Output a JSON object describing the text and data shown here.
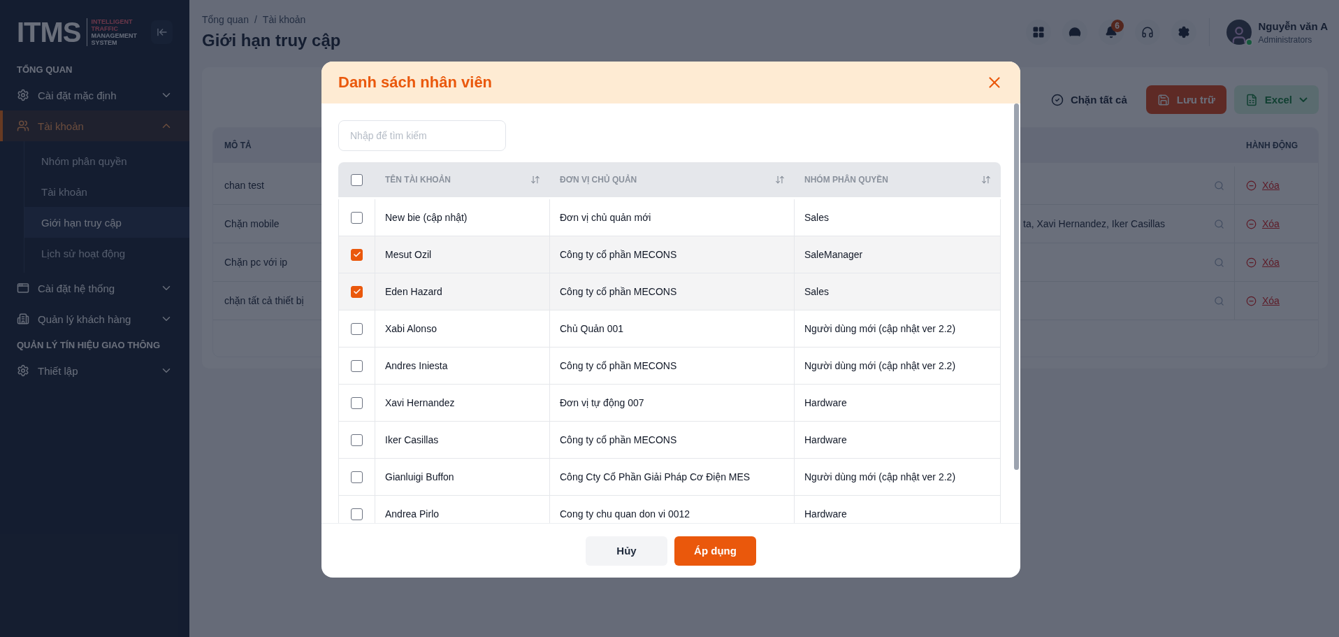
{
  "sidebar": {
    "logo": {
      "mark": "ITMS",
      "tagline": [
        "INTELLIGENT",
        "TRAFFIC",
        "MANAGEMENT",
        "SYSTEM"
      ]
    },
    "sections": [
      {
        "heading": "TỔNG QUAN",
        "items": [
          {
            "label": "Cài đặt mặc định",
            "selected": false,
            "expanded": false
          },
          {
            "label": "Tài khoản",
            "selected": true,
            "expanded": true,
            "children": [
              {
                "label": "Nhóm phân quyền",
                "selected": false
              },
              {
                "label": "Tài khoản",
                "selected": false
              },
              {
                "label": "Giới hạn truy cập",
                "selected": true
              },
              {
                "label": "Lịch sử hoạt động",
                "selected": false
              }
            ]
          },
          {
            "label": "Cài đặt hệ thống",
            "selected": false,
            "expanded": false
          },
          {
            "label": "Quản lý khách hàng",
            "selected": false,
            "expanded": false
          }
        ]
      },
      {
        "heading": "QUẢN LÝ TÍN HIỆU GIAO THÔNG",
        "items": [
          {
            "label": "Thiết lập",
            "selected": false,
            "expanded": false
          }
        ]
      }
    ]
  },
  "header": {
    "breadcrumb": [
      "Tổng quan",
      "Tài khoản"
    ],
    "separator": "/",
    "title": "Giới hạn truy cập",
    "notification_count": "6",
    "user": {
      "name": "Nguyễn văn A",
      "role": "Administrators"
    }
  },
  "toolbar": {
    "buttons": [
      {
        "label": "Chặn tất cả",
        "kind": "outline"
      },
      {
        "label": "Lưu trữ",
        "kind": "primary"
      },
      {
        "label": "Excel",
        "kind": "excel"
      }
    ]
  },
  "table": {
    "columns": [
      "MÔ TẢ",
      "HÀNH ĐỘNG"
    ],
    "rows": [
      {
        "description": "chan test",
        "action": "Xóa"
      },
      {
        "description": "Chặn mobile",
        "column_3": "ta, Xavi Hernandez, Iker Casillas",
        "action": "Xóa"
      },
      {
        "description": "Chặn pc với ip",
        "action": "Xóa"
      },
      {
        "description": "chặn tất cả thiết bị",
        "action": "Xóa"
      }
    ]
  },
  "modal": {
    "title": "Danh sách nhân viên",
    "search": {
      "placeholder": "Nhập để tìm kiếm"
    },
    "select_all": {
      "checked": false
    },
    "columns": [
      {
        "label": "TÊN TÀI KHOẢN",
        "sortable": true
      },
      {
        "label": "ĐƠN VỊ CHỦ QUẢN",
        "sortable": true
      },
      {
        "label": "NHÓM PHÂN QUYỀN",
        "sortable": true
      }
    ],
    "rows": [
      {
        "name": "New bie (cập nhật)",
        "unit": "Đơn vị chủ quản mới",
        "group": "Sales",
        "checked": false
      },
      {
        "name": "Mesut Ozil",
        "unit": "Công ty cổ phần MECONS",
        "group": "SaleManager",
        "checked": true
      },
      {
        "name": "Eden Hazard",
        "unit": "Công ty cổ phần MECONS",
        "group": "Sales",
        "checked": true
      },
      {
        "name": "Xabi Alonso",
        "unit": "Chủ Quản 001",
        "group": "Người dùng mới (cập nhật ver 2.2)",
        "checked": false
      },
      {
        "name": "Andres Iniesta",
        "unit": "Công ty cổ phần MECONS",
        "group": "Người dùng mới (cập nhật ver 2.2)",
        "checked": false
      },
      {
        "name": "Xavi Hernandez",
        "unit": "Đơn vị tự động 007",
        "group": "Hardware",
        "checked": false
      },
      {
        "name": "Iker Casillas",
        "unit": "Công ty cổ phần MECONS",
        "group": "Hardware",
        "checked": false
      },
      {
        "name": "Gianluigi Buffon",
        "unit": "Công Cty Cổ Phần Giải Pháp Cơ Điện MES",
        "group": "Người dùng mới (cập nhật ver 2.2)",
        "checked": false
      },
      {
        "name": "Andrea Pirlo",
        "unit": "Cong ty chu quan don vi 0012",
        "group": "Hardware",
        "checked": false
      }
    ],
    "buttons": [
      {
        "label": "Hủy",
        "kind": "secondary"
      },
      {
        "label": "Áp dụng",
        "kind": "primary"
      }
    ]
  }
}
